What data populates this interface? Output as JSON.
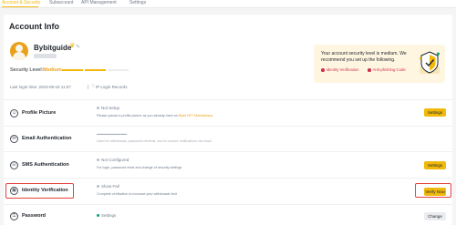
{
  "tabs": [
    {
      "label": "Account & Security",
      "active": true
    },
    {
      "label": "Subaccount",
      "active": false
    },
    {
      "label": "API Management",
      "active": false
    },
    {
      "label": "Settings",
      "active": false
    }
  ],
  "page": {
    "title": "Account Info"
  },
  "profile": {
    "username": "Bybitguide",
    "security_level_label": "Security Level:",
    "security_level_value": "Medium",
    "security_level_segments_filled": 2,
    "security_level_segments_total": 3,
    "last_login": "Last login time: 2023-09-18 11:57",
    "ip_label": "IP Login Records"
  },
  "banner": {
    "title": "Your account security level is medium. We recommend you set up the following.",
    "items": [
      "Identity Verification",
      "Anti-phishing Code"
    ]
  },
  "rows": [
    {
      "label": "Profile Picture",
      "status": "Not Setup",
      "status_color": "gray",
      "desc": "Please upload a profile picture as you already have an ",
      "desc_link": "Bybit NFT Marketplace",
      "desc_blurred": false,
      "button": "Settings",
      "button_style": "yellow",
      "icon": "user-icon"
    },
    {
      "label": "Email Authentication",
      "status": "",
      "status_color": "",
      "desc": "Used for withdrawal, password retrieval, and to receive notifications via email.",
      "desc_link": "",
      "desc_blurred": true,
      "button": "",
      "button_style": "",
      "icon": "mail-icon"
    },
    {
      "label": "SMS Authentication",
      "status": "Not Configured",
      "status_color": "gray",
      "desc": "For login, password reset and change of security settings",
      "desc_link": "",
      "desc_blurred": false,
      "button": "Settings",
      "button_style": "yellow",
      "icon": "phone-icon"
    },
    {
      "label": "Identity Verification",
      "status": "Show Fail",
      "status_color": "gray",
      "desc": "Complete verification to increase your withdrawal limit",
      "desc_link": "",
      "desc_blurred": false,
      "button": "Verify Now",
      "button_style": "yellow",
      "icon": "id-card-icon"
    },
    {
      "label": "Password",
      "status": "Settings",
      "status_color": "green",
      "desc": "",
      "desc_link": "",
      "desc_blurred": false,
      "button": "Change",
      "button_style": "gray",
      "icon": "lock-icon"
    }
  ],
  "colors": {
    "accent": "#f0b90b",
    "highlight": "#e2413d",
    "warning": "#cf304a"
  }
}
